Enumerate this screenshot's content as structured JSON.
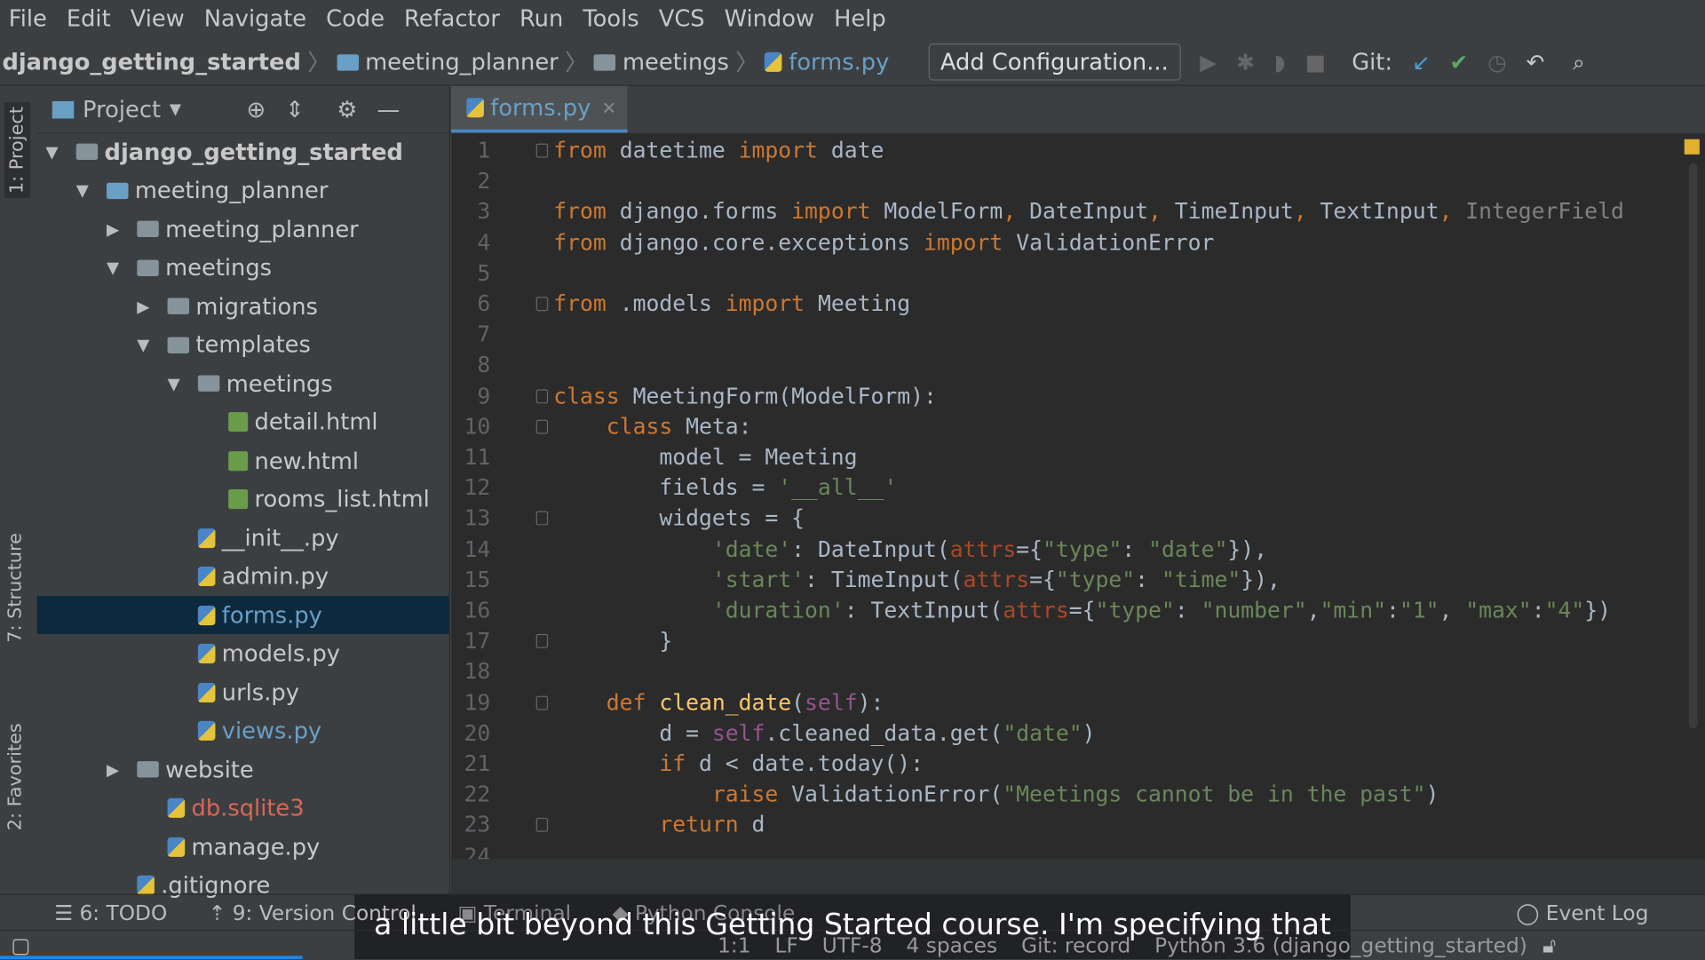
{
  "menu": [
    "File",
    "Edit",
    "View",
    "Navigate",
    "Code",
    "Refactor",
    "Run",
    "Tools",
    "VCS",
    "Window",
    "Help"
  ],
  "breadcrumb": [
    "django_getting_started",
    "meeting_planner",
    "meetings",
    "forms.py"
  ],
  "toolbar": {
    "add_config": "Add Configuration...",
    "git_label": "Git:"
  },
  "left_tabs": {
    "project": "1: Project",
    "structure": "7: Structure",
    "favorites": "2: Favorites"
  },
  "project_panel": {
    "title": "Project"
  },
  "tree": [
    {
      "label": "django_getting_started",
      "depth": 0,
      "arrow": "▼",
      "icon": "folder",
      "bold": true
    },
    {
      "label": "meeting_planner",
      "depth": 1,
      "arrow": "▼",
      "icon": "folder-blue"
    },
    {
      "label": "meeting_planner",
      "depth": 2,
      "arrow": "▶",
      "icon": "folder"
    },
    {
      "label": "meetings",
      "depth": 2,
      "arrow": "▼",
      "icon": "folder"
    },
    {
      "label": "migrations",
      "depth": 3,
      "arrow": "▶",
      "icon": "folder"
    },
    {
      "label": "templates",
      "depth": 3,
      "arrow": "▼",
      "icon": "folder"
    },
    {
      "label": "meetings",
      "depth": 4,
      "arrow": "▼",
      "icon": "folder"
    },
    {
      "label": "detail.html",
      "depth": 5,
      "icon": "html"
    },
    {
      "label": "new.html",
      "depth": 5,
      "icon": "html"
    },
    {
      "label": "rooms_list.html",
      "depth": 5,
      "icon": "html"
    },
    {
      "label": "__init__.py",
      "depth": 4,
      "icon": "py"
    },
    {
      "label": "admin.py",
      "depth": 4,
      "icon": "py"
    },
    {
      "label": "forms.py",
      "depth": 4,
      "icon": "py",
      "selected": true,
      "color": "#6a9fc5"
    },
    {
      "label": "models.py",
      "depth": 4,
      "icon": "py"
    },
    {
      "label": "urls.py",
      "depth": 4,
      "icon": "py"
    },
    {
      "label": "views.py",
      "depth": 4,
      "icon": "py",
      "color": "#6a9fc5"
    },
    {
      "label": "website",
      "depth": 2,
      "arrow": "▶",
      "icon": "folder"
    },
    {
      "label": "db.sqlite3",
      "depth": 3,
      "icon": "py",
      "color": "#d9665a"
    },
    {
      "label": "manage.py",
      "depth": 3,
      "icon": "py"
    },
    {
      "label": ".gitignore",
      "depth": 2,
      "icon": "py"
    }
  ],
  "editor": {
    "tab": "forms.py"
  },
  "code": [
    [
      [
        "from",
        "kw"
      ],
      [
        " datetime ",
        ""
      ],
      [
        "import",
        "kw"
      ],
      [
        " date",
        ""
      ]
    ],
    [],
    [
      [
        "from",
        "kw"
      ],
      [
        " django.forms ",
        ""
      ],
      [
        "import",
        "kw"
      ],
      [
        " ModelForm",
        ""
      ],
      [
        ", ",
        "kw"
      ],
      [
        "DateInput",
        ""
      ],
      [
        ", ",
        "kw"
      ],
      [
        "TimeInput",
        ""
      ],
      [
        ", ",
        "kw"
      ],
      [
        "TextInput",
        ""
      ],
      [
        ", ",
        "kw"
      ],
      [
        "IntegerField",
        "gr"
      ]
    ],
    [
      [
        "from",
        "kw"
      ],
      [
        " django.core.exceptions ",
        ""
      ],
      [
        "import",
        "kw"
      ],
      [
        " ValidationError",
        ""
      ]
    ],
    [],
    [
      [
        "from",
        "kw"
      ],
      [
        " .models ",
        ""
      ],
      [
        "import",
        "kw"
      ],
      [
        " Meeting",
        ""
      ]
    ],
    [],
    [],
    [
      [
        "class",
        "kw"
      ],
      [
        " MeetingForm(ModelForm):",
        ""
      ]
    ],
    [
      [
        "    class",
        "kw"
      ],
      [
        " Meta:",
        ""
      ]
    ],
    [
      [
        "        model = Meeting",
        ""
      ]
    ],
    [
      [
        "        fields = ",
        ""
      ],
      [
        "'__all__'",
        "st"
      ]
    ],
    [
      [
        "        widgets = {",
        ""
      ]
    ],
    [
      [
        "            ",
        ""
      ],
      [
        "'date'",
        "st"
      ],
      [
        ": DateInput(",
        ""
      ],
      [
        "attrs",
        "pa"
      ],
      [
        "={",
        ""
      ],
      [
        "\"type\"",
        "st"
      ],
      [
        ": ",
        ""
      ],
      [
        "\"date\"",
        "st"
      ],
      [
        "}),",
        ""
      ]
    ],
    [
      [
        "            ",
        ""
      ],
      [
        "'start'",
        "st"
      ],
      [
        ": TimeInput(",
        ""
      ],
      [
        "attrs",
        "pa"
      ],
      [
        "={",
        ""
      ],
      [
        "\"type\"",
        "st"
      ],
      [
        ": ",
        ""
      ],
      [
        "\"time\"",
        "st"
      ],
      [
        "}),",
        ""
      ]
    ],
    [
      [
        "            ",
        ""
      ],
      [
        "'duration'",
        "st"
      ],
      [
        ": TextInput(",
        ""
      ],
      [
        "attrs",
        "pa"
      ],
      [
        "={",
        ""
      ],
      [
        "\"type\"",
        "st"
      ],
      [
        ": ",
        ""
      ],
      [
        "\"number\"",
        "st"
      ],
      [
        ",",
        ""
      ],
      [
        "\"min\"",
        "st"
      ],
      [
        ":",
        ""
      ],
      [
        "\"1\"",
        "st"
      ],
      [
        ", ",
        ""
      ],
      [
        "\"max\"",
        "st"
      ],
      [
        ":",
        ""
      ],
      [
        "\"4\"",
        "st"
      ],
      [
        "})",
        ""
      ]
    ],
    [
      [
        "        }",
        ""
      ]
    ],
    [],
    [
      [
        "    def ",
        "kw"
      ],
      [
        "clean_date",
        "fn"
      ],
      [
        "(",
        ""
      ],
      [
        "self",
        "sf"
      ],
      [
        "):",
        ""
      ]
    ],
    [
      [
        "        d = ",
        ""
      ],
      [
        "self",
        "sf"
      ],
      [
        ".cleaned_data.get(",
        ""
      ],
      [
        "\"date\"",
        "st"
      ],
      [
        ")",
        ""
      ]
    ],
    [
      [
        "        if",
        "kw"
      ],
      [
        " d < date.today():",
        ""
      ]
    ],
    [
      [
        "            raise",
        "kw"
      ],
      [
        " ValidationError(",
        ""
      ],
      [
        "\"Meetings cannot be in the past\"",
        "st"
      ],
      [
        ")",
        ""
      ]
    ],
    [
      [
        "        return",
        "kw"
      ],
      [
        " d",
        ""
      ]
    ],
    []
  ],
  "fold_lines": [
    1,
    6,
    9,
    10,
    13,
    17,
    19,
    23
  ],
  "bottom_tabs": [
    "6: TODO",
    "9: Version Control",
    "Terminal",
    "Python Console"
  ],
  "event_log": "Event Log",
  "status": [
    "1:1",
    "LF",
    "UTF-8",
    "4 spaces",
    "Git: record",
    "Python 3.6 (django_getting_started)"
  ],
  "subtitle": "a little bit beyond this Getting Started course. I'm specifying that"
}
